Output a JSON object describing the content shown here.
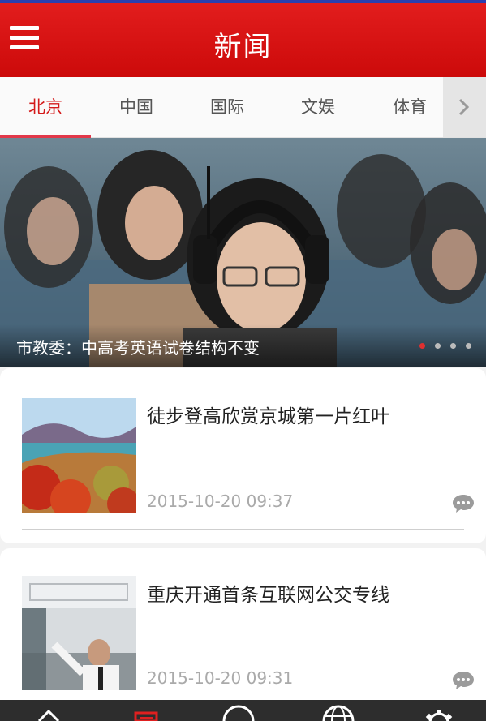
{
  "header": {
    "title": "新闻"
  },
  "tabs": [
    {
      "label": "北京",
      "active": true
    },
    {
      "label": "中国",
      "active": false
    },
    {
      "label": "国际",
      "active": false
    },
    {
      "label": "文娱",
      "active": false
    },
    {
      "label": "体育",
      "active": false
    }
  ],
  "hero": {
    "caption": "市教委：中高考英语试卷结构不变",
    "slide_count": 4,
    "active_slide": 1
  },
  "news": [
    {
      "title": "徒步登高欣赏京城第一片红叶",
      "time": "2015-10-20 09:37",
      "thumb_icon": "red-leaves-landscape-photo"
    },
    {
      "title": "重庆开通首条互联网公交专线",
      "time": "2015-10-20 09:31",
      "thumb_icon": "bus-driver-photo"
    }
  ],
  "bottom_nav": [
    {
      "icon": "home-icon"
    },
    {
      "icon": "news-icon",
      "active": true
    },
    {
      "icon": "circle-icon"
    },
    {
      "icon": "globe-icon"
    },
    {
      "icon": "settings-icon"
    }
  ],
  "colors": {
    "brand_red": "#d41a1a",
    "tab_underline": "#e2384a",
    "time_gray": "#aaaaaa"
  }
}
